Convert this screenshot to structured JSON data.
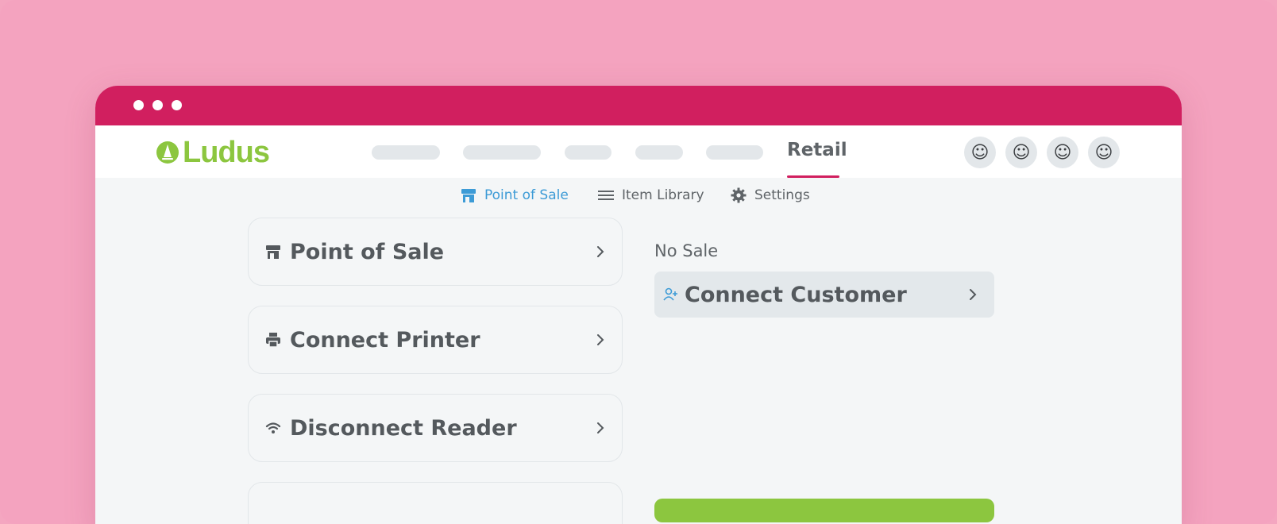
{
  "app": {
    "logo_text": "Ludus"
  },
  "colors": {
    "accent": "#d11f5f",
    "brand_green": "#8cc63f",
    "active_blue": "#3d9bd6",
    "background": "#f4a6c0"
  },
  "top_nav": {
    "active_tab": "Retail",
    "avatar_glyph": "☺"
  },
  "sub_nav": {
    "items": [
      {
        "label": "Point of Sale",
        "icon": "store-icon",
        "active": true
      },
      {
        "label": "Item Library",
        "icon": "list-icon",
        "active": false
      },
      {
        "label": "Settings",
        "icon": "gear-icon",
        "active": false
      }
    ]
  },
  "actions": {
    "items": [
      {
        "label": "Point of Sale",
        "icon": "store-icon"
      },
      {
        "label": "Connect Printer",
        "icon": "printer-icon"
      },
      {
        "label": "Disconnect Reader",
        "icon": "wifi-icon"
      }
    ]
  },
  "sale": {
    "status": "No Sale",
    "connect_customer_label": "Connect Customer"
  }
}
